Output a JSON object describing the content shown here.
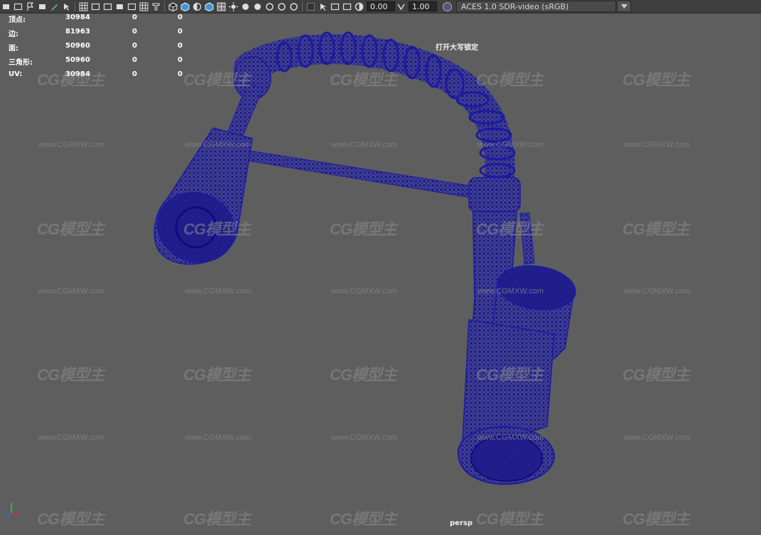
{
  "toolbar": {
    "icons": [
      "camera-icon",
      "camera-attribute-icon",
      "bookmark-icon",
      "image-plane-icon",
      "grease-pencil-icon",
      "pan-zoom-icon",
      "grid-icon",
      "film-gate-icon",
      "resolution-gate-icon",
      "gate-mask-icon",
      "field-chart-icon",
      "safe-action-icon",
      "safe-title-icon",
      "wireframe-icon",
      "smooth-shade-icon",
      "shade-selected-icon",
      "wireframe-on-shaded-icon",
      "textured-icon",
      "use-lights-icon",
      "shadows-icon",
      "screen-space-ao-icon",
      "motion-blur-icon",
      "anti-aliasing-icon",
      "depth-of-field-icon",
      "isolate-select-icon",
      "xray-icon",
      "xray-joints-icon",
      "xray-components-icon",
      "exposure-icon",
      "gamma-icon",
      "color-management-icon"
    ],
    "exposure": "0.00",
    "gamma": "1.00",
    "color_space": "ACES 1.0 SDR-video (sRGB)"
  },
  "hud": {
    "rows": [
      {
        "label": "顶点:",
        "value": "30984",
        "sel": "0",
        "sel2": "0"
      },
      {
        "label": "边:",
        "value": "81963",
        "sel": "0",
        "sel2": "0"
      },
      {
        "label": "面:",
        "value": "50960",
        "sel": "0",
        "sel2": "0"
      },
      {
        "label": "三角形:",
        "value": "50960",
        "sel": "0",
        "sel2": "0"
      },
      {
        "label": "UV:",
        "value": "30984",
        "sel": "0",
        "sel2": "0"
      }
    ]
  },
  "caps_lock_message": "打开大写锁定",
  "camera_name": "persp",
  "watermark": {
    "logo": "CG模型主",
    "url": "www.CGMXW.com"
  },
  "colors": {
    "viewport_bg": "#5e5e5e",
    "wireframe": "#1c1aa0",
    "hud_text": "#ffffff"
  }
}
